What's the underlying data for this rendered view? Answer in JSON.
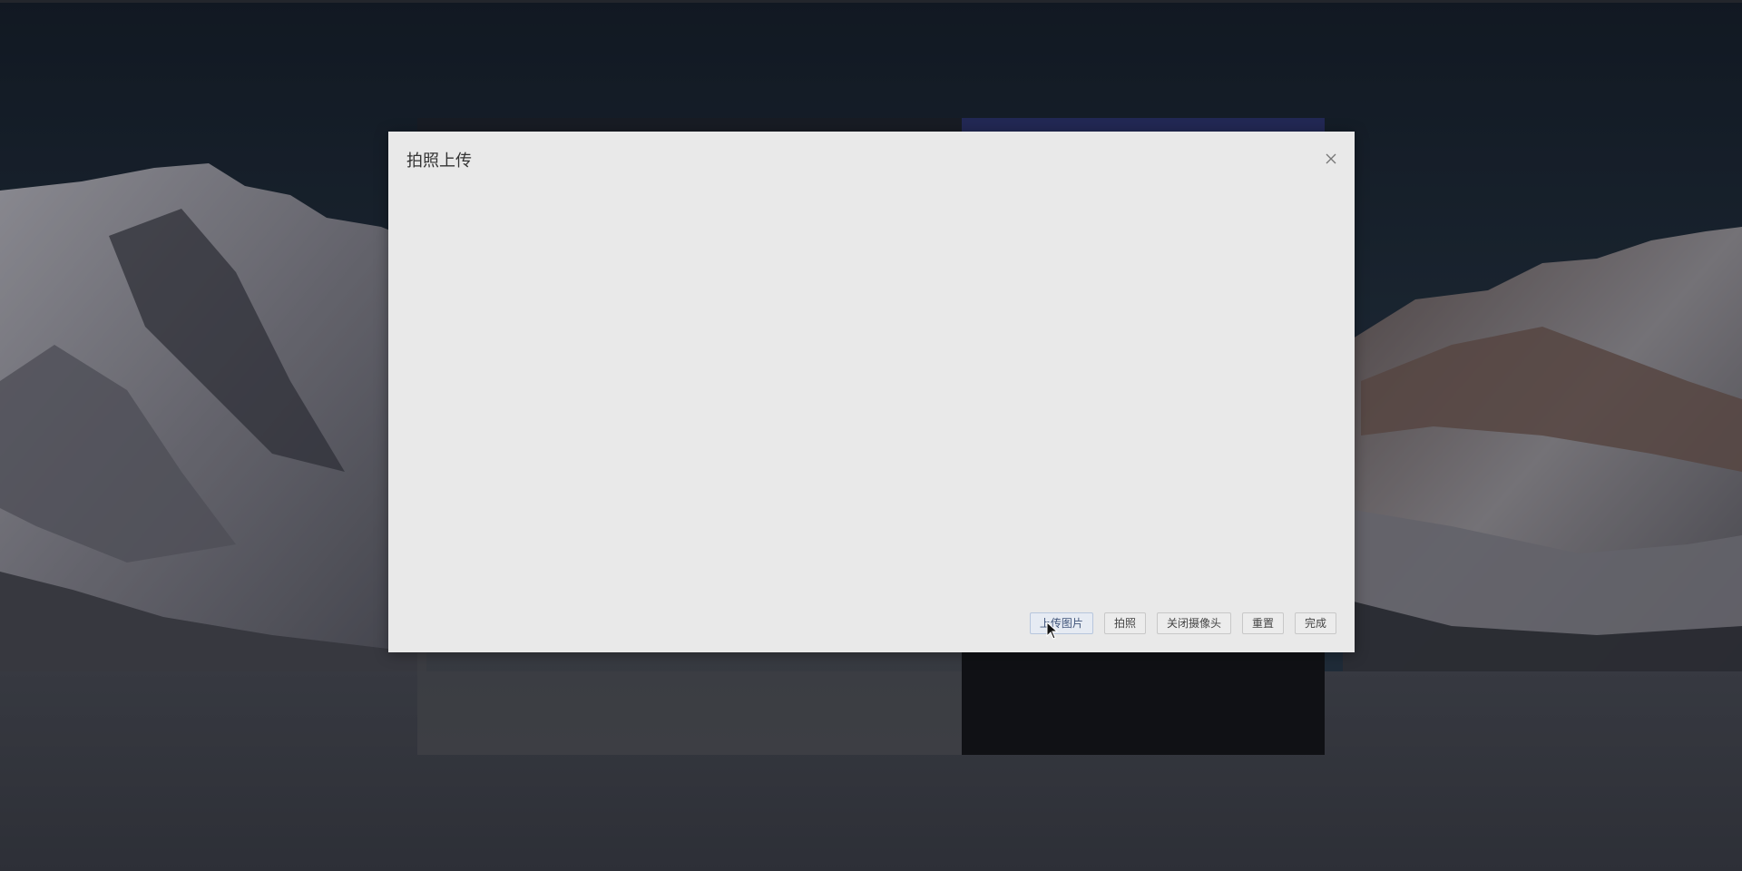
{
  "modal": {
    "title": "拍照上传",
    "close_icon": "close-icon",
    "buttons": {
      "upload_image": "上传图片",
      "take_photo": "拍照",
      "close_camera": "关闭摄像头",
      "reset": "重置",
      "done": "完成"
    }
  },
  "colors": {
    "modal_background": "#e9e9e9",
    "active_button_text": "#41557a",
    "sky": "#1d2b38",
    "underlying_header": "#2a3270"
  }
}
